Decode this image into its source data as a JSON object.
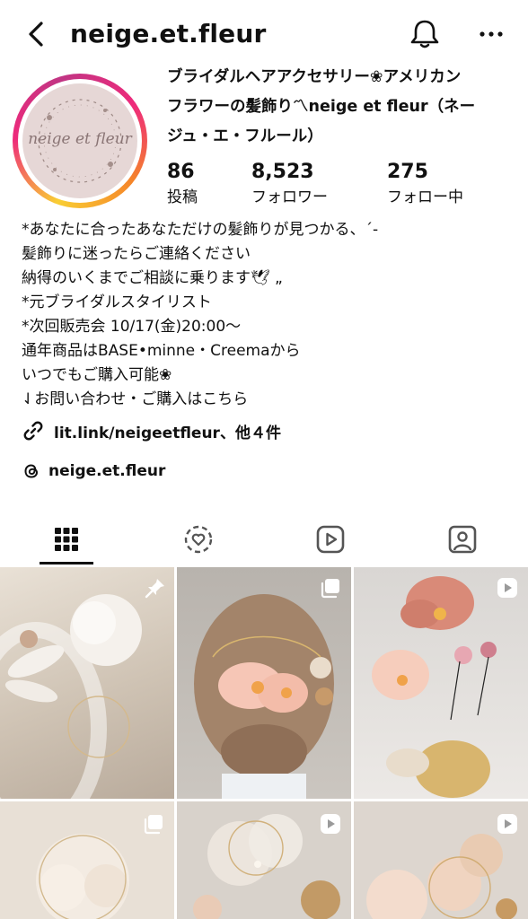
{
  "header": {
    "username": "neige.et.fleur"
  },
  "profile": {
    "avatar_text": "neige et fleur",
    "full_name_lines": [
      "ブライダルヘアアクセサリー❀アメリカン",
      "フラワーの髪飾り〽neige et fleur（ネー",
      "ジュ・エ・フルール）"
    ],
    "stats": [
      {
        "value": "86",
        "label": "投稿"
      },
      {
        "value": "8,523",
        "label": "フォロワー"
      },
      {
        "value": "275",
        "label": "フォロー中"
      }
    ],
    "bio_lines": [
      "*あなたに合ったあなただけの髪飾りが見つかる、´-",
      "髪飾りに迷ったらご連絡ください",
      "納得のいくまでご相談に乗ります🕊 „",
      "*元ブライダルスタイリスト",
      "*次回販売会 10/17(金)20:00～",
      "通年商品はBASE•minne・Creemaから",
      "いつでもご購入可能❀",
      "⇃お問い合わせ・ご購入はこちら"
    ],
    "link_text": "lit.link/neigeetfleur、他４件",
    "threads_handle": "neige.et.fleur"
  },
  "tabs": [
    {
      "name": "posts",
      "icon": "grid-icon",
      "active": true
    },
    {
      "name": "reposts",
      "icon": "repost-heart-icon",
      "active": false
    },
    {
      "name": "reels",
      "icon": "reels-icon",
      "active": false
    },
    {
      "name": "tagged",
      "icon": "tagged-person-icon",
      "active": false
    }
  ],
  "grid": [
    {
      "badge": "pin-icon"
    },
    {
      "badge": "carousel-icon"
    },
    {
      "badge": "reel-icon"
    },
    {
      "badge": "carousel-icon"
    },
    {
      "badge": "reel-icon"
    },
    {
      "badge": "reel-icon"
    }
  ],
  "colors": {
    "text": "#111111",
    "ring_gradient": [
      "#f9ce34",
      "#ee2a7b",
      "#c13584",
      "#f58529"
    ],
    "avatar_bg": "#e6d7d6"
  }
}
